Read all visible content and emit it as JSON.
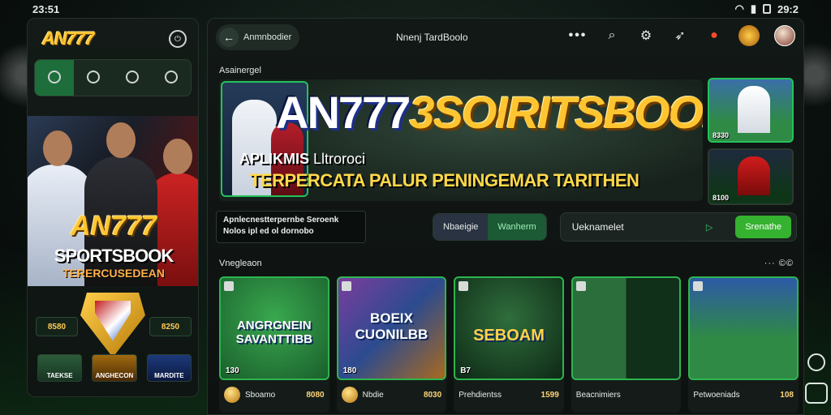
{
  "status": {
    "time_left": "23:51",
    "time_right": "29:2"
  },
  "phone": {
    "logo": "AN777",
    "nav": [
      "",
      "",
      "",
      ""
    ],
    "brand": "AN777",
    "brand_sub": "SPORTSBOOK",
    "brand_sub2": "TERERCUSEDEAN",
    "left_value": "8580",
    "right_value": "8250",
    "thumbs": [
      "TAEKSE",
      "ANGHECON",
      "MARDITE"
    ]
  },
  "topbar": {
    "back_label": "Anmnbodier",
    "title": "Nnenj TardBoolo"
  },
  "section": {
    "label": "Asainergel"
  },
  "banner": {
    "title_white": "AN777",
    "title_gold": "3SOIRITSBOOK",
    "sub1_bold": "APLIKMIS",
    "sub1_light": "Lltroroci",
    "sub2": "TERPERCATA PALUR PENINGEMAR TARITHEN",
    "side1_label": "8330",
    "side2_label": "8100"
  },
  "info": {
    "line1": "Apnlecnestterpernbe Seroenk",
    "line2": "Nolos ipl ed ol dornobo",
    "pill1": "Nbaeigie",
    "pill2": "Wanherm",
    "field_label": "Ueknamelet",
    "field_btn": "Srenathe"
  },
  "grid": {
    "label": "Vnegleaon",
    "more": "··· ©©",
    "cards": [
      {
        "title": "ANGRGNEIN SAVANTTIBB",
        "num": "130",
        "name": "Sboamo",
        "value": "8080"
      },
      {
        "title": "BOEIX CUONILBB",
        "num": "180",
        "name": "Nbdie",
        "value": "8030"
      },
      {
        "title": "SEBOAM",
        "num": "B7",
        "name": "Prehdientss",
        "value": "1599"
      },
      {
        "title": "",
        "num": "",
        "name": "Beacnimiers",
        "value": ""
      },
      {
        "title": "",
        "num": "",
        "name": "Petwoeniads",
        "value": "108"
      }
    ]
  },
  "colors": {
    "accent": "#24c25a",
    "gold": "#ffc531"
  }
}
